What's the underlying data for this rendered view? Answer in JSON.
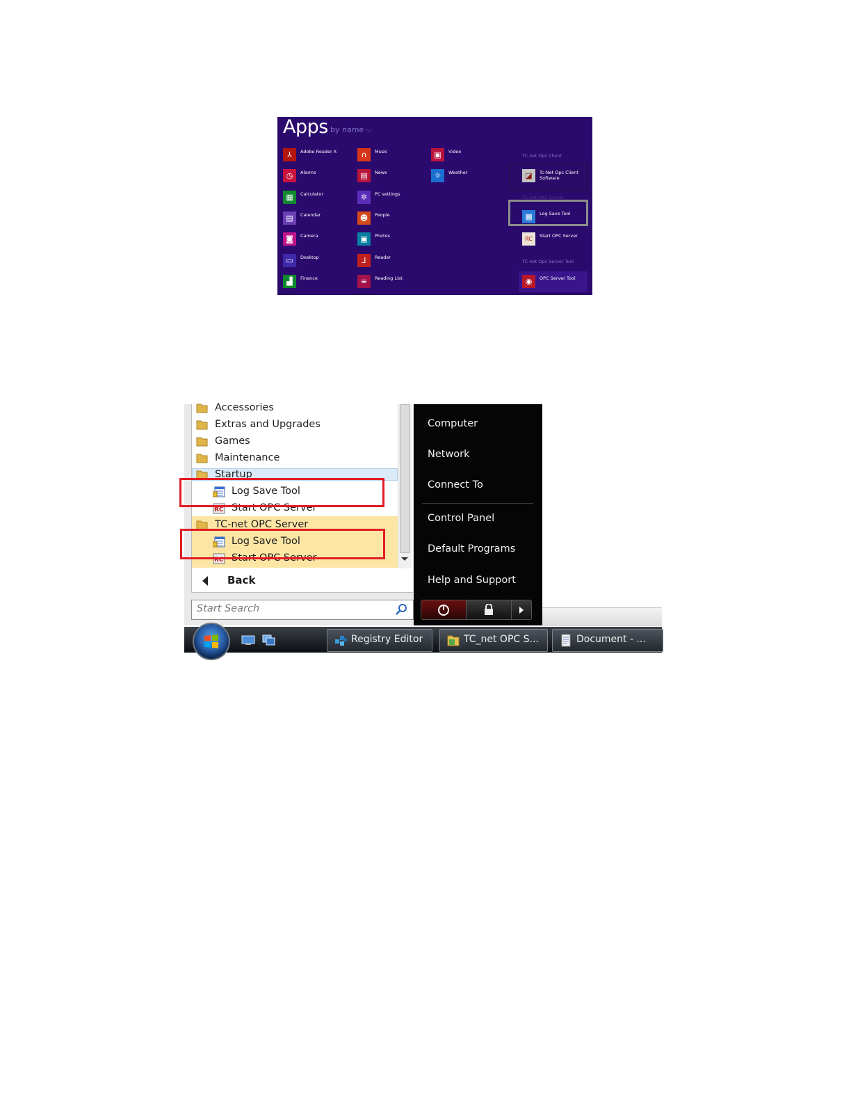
{
  "win8_apps": {
    "title": "Apps",
    "sort_label": "by name ⌵",
    "columns": [
      [
        {
          "label": "Adobe Reader X",
          "icon": "pdf-icon",
          "color": "#b4160e"
        },
        {
          "label": "Alarms",
          "icon": "alarm-clock-icon",
          "color": "#c8123e"
        },
        {
          "label": "Calculator",
          "icon": "calculator-icon",
          "color": "#128a2f"
        },
        {
          "label": "Calendar",
          "icon": "calendar-icon",
          "color": "#6a3fb3"
        },
        {
          "label": "Camera",
          "icon": "camera-icon",
          "color": "#c0148a"
        },
        {
          "label": "Desktop",
          "icon": "desktop-icon",
          "color": "#3e2aa8"
        },
        {
          "label": "Finance",
          "icon": "finance-chart-icon",
          "color": "#0e8a2c"
        }
      ],
      [
        {
          "label": "Music",
          "icon": "headphones-icon",
          "color": "#d6361a"
        },
        {
          "label": "News",
          "icon": "news-icon",
          "color": "#b7143c"
        },
        {
          "label": "PC settings",
          "icon": "gear-icon",
          "color": "#5a2eb8"
        },
        {
          "label": "People",
          "icon": "people-icon",
          "color": "#d24a1c"
        },
        {
          "label": "Photos",
          "icon": "photos-icon",
          "color": "#0b7fa2"
        },
        {
          "label": "Reader",
          "icon": "reader-icon",
          "color": "#c0201e"
        },
        {
          "label": "Reading List",
          "icon": "reading-list-icon",
          "color": "#a3124a"
        }
      ],
      [
        {
          "label": "Video",
          "icon": "video-icon",
          "color": "#b8143e"
        },
        {
          "label": "Weather",
          "icon": "weather-sun-icon",
          "color": "#1a6fd0"
        }
      ]
    ],
    "groups": [
      {
        "header": "TC-net Opc Client",
        "items": [
          {
            "label": "Tc-Net Opc Client Software",
            "icon": "tc-net-client-icon"
          }
        ]
      },
      {
        "header": "TC-net OPC Server",
        "items": [
          {
            "label": "Log Save Tool",
            "icon": "log-save-tool-icon"
          },
          {
            "label": "Start OPC Server",
            "icon": "start-opc-server-icon"
          }
        ]
      },
      {
        "header": "TC-net Opc Server Tool",
        "items": [
          {
            "label": "OPC Server Tool",
            "icon": "opc-server-tool-icon"
          }
        ]
      }
    ]
  },
  "vista_menu": {
    "programs": [
      {
        "label": "Accessories",
        "type": "folder"
      },
      {
        "label": "Extras and Upgrades",
        "type": "folder"
      },
      {
        "label": "Games",
        "type": "folder"
      },
      {
        "label": "Maintenance",
        "type": "folder"
      },
      {
        "label": "Startup",
        "type": "folder"
      },
      {
        "label": "Log Save Tool",
        "type": "app"
      },
      {
        "label": "Start OPC Server",
        "type": "app"
      },
      {
        "label": "TC-net OPC Server",
        "type": "folder"
      },
      {
        "label": "Log Save Tool",
        "type": "app"
      },
      {
        "label": "Start OPC Server",
        "type": "app"
      }
    ],
    "back_label": "Back",
    "search_placeholder": "Start Search",
    "right_pane": [
      "Computer",
      "Network",
      "Connect To",
      "Control Panel",
      "Default Programs",
      "Help and Support"
    ],
    "taskbar": [
      "Registry Editor",
      "TC_net OPC S...",
      "Document - ..."
    ],
    "colors": {
      "highlight": "#fde6a4",
      "selection": "#dbeaf8",
      "outline": "#e21b24"
    }
  }
}
